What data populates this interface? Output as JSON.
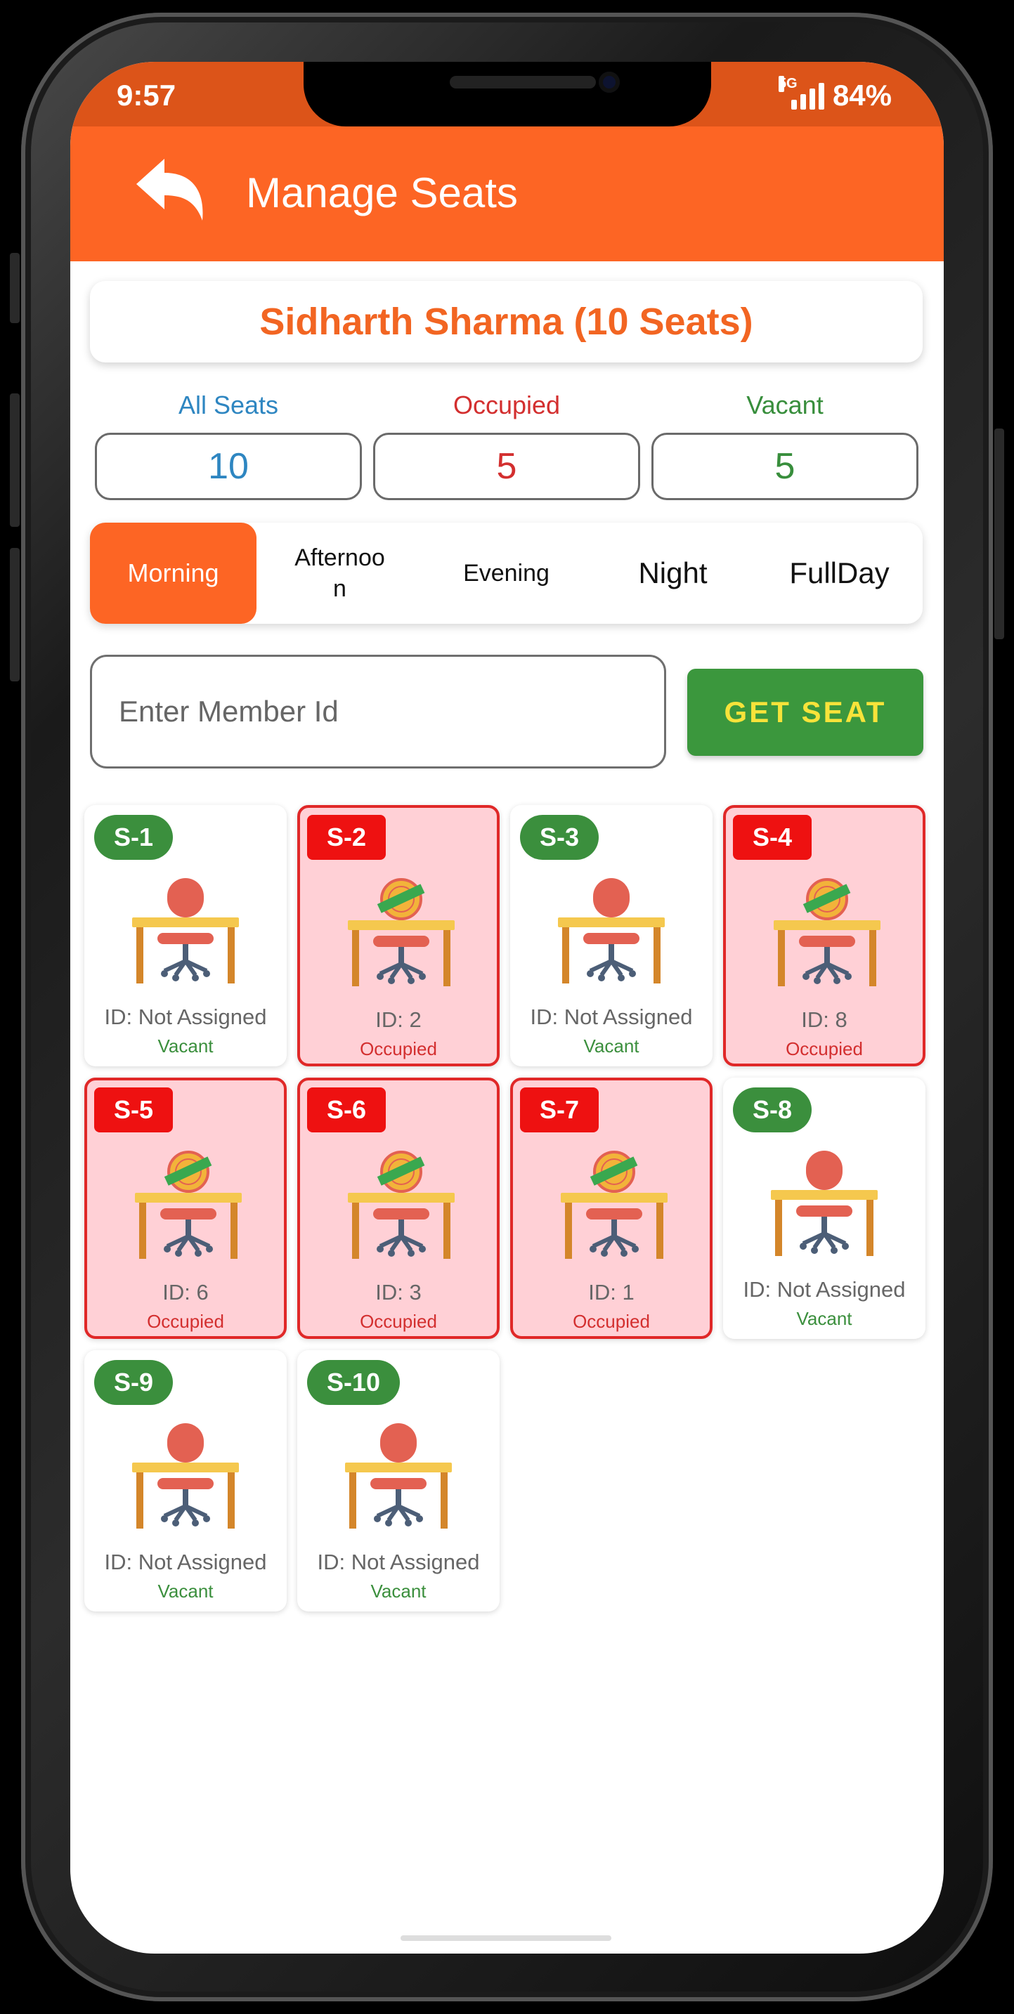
{
  "status_bar": {
    "time": "9:57",
    "network": "5G",
    "battery": "84%"
  },
  "app_bar": {
    "title": "Manage Seats",
    "back_icon": "reply-arrow-icon"
  },
  "owner": {
    "title": "Sidharth Sharma (10 Seats)"
  },
  "stats": [
    {
      "label": "All Seats",
      "value": "10",
      "color": "#2e86c1"
    },
    {
      "label": "Occupied",
      "value": "5",
      "color": "#d32f2f"
    },
    {
      "label": "Vacant",
      "value": "5",
      "color": "#388e3c"
    }
  ],
  "shifts": [
    {
      "label": "Afternoo\nn",
      "active": false
    },
    {
      "label": "Evening",
      "active": false
    },
    {
      "label": "Night",
      "active": false
    },
    {
      "label": "FullDay",
      "active": false
    }
  ],
  "active_shift": "Morning",
  "member_input": {
    "placeholder": "Enter Member Id",
    "value": ""
  },
  "get_seat_label": "GET SEAT",
  "colors": {
    "primary": "#fd6524",
    "status_bar": "#dc5419",
    "vacant_badge": "#3b8f3d",
    "occupied_badge": "#ee1111",
    "occupied_bg": "#ffd0d6",
    "occupied_text": "#d32f2f",
    "vacant_text": "#3b8f3d",
    "get_seat_text": "#f7e33a"
  },
  "seats": [
    {
      "label": "S-1",
      "id_text": "ID: Not Assigned",
      "status": "Vacant"
    },
    {
      "label": "S-2",
      "id_text": "ID: 2",
      "status": "Occupied"
    },
    {
      "label": "S-3",
      "id_text": "ID: Not Assigned",
      "status": "Vacant"
    },
    {
      "label": "S-4",
      "id_text": "ID: 8",
      "status": "Occupied"
    },
    {
      "label": "S-5",
      "id_text": "ID: 6",
      "status": "Occupied"
    },
    {
      "label": "S-6",
      "id_text": "ID: 3",
      "status": "Occupied"
    },
    {
      "label": "S-7",
      "id_text": "ID: 1",
      "status": "Occupied"
    },
    {
      "label": "S-8",
      "id_text": "ID: Not Assigned",
      "status": "Vacant"
    },
    {
      "label": "S-9",
      "id_text": "ID: Not Assigned",
      "status": "Vacant"
    },
    {
      "label": "S-10",
      "id_text": "ID: Not Assigned",
      "status": "Vacant"
    }
  ]
}
